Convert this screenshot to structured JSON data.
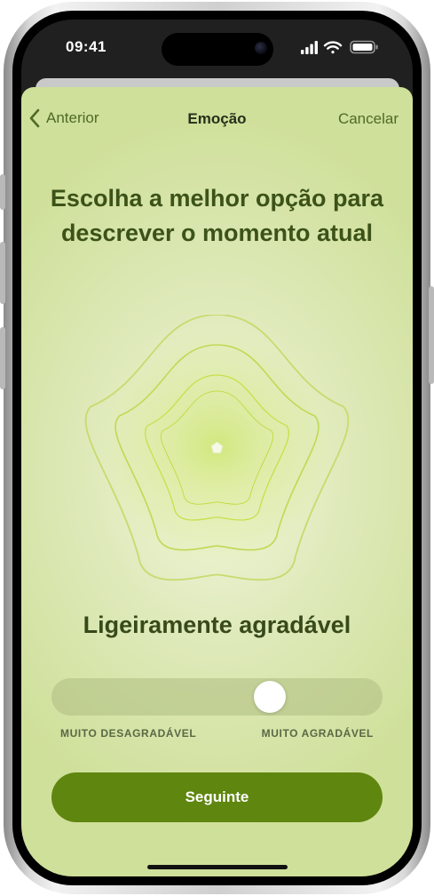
{
  "status_bar": {
    "time": "09:41"
  },
  "nav": {
    "back_label": "Anterior",
    "title": "Emoção",
    "cancel_label": "Cancelar"
  },
  "question": "Escolha a melhor opção para descrever o momento atual",
  "mood_label": "Ligeiramente agradável",
  "slider": {
    "value_fraction": 0.68,
    "min_label": "MUITO DESAGRADÁVEL",
    "max_label": "MUITO AGRADÁVEL"
  },
  "next_button_label": "Seguinte",
  "colors": {
    "accent": "#5f860f",
    "sheet_bg": "#dfeabb",
    "text_dark": "#3c5219"
  },
  "icons": [
    "chevron-left-icon",
    "signal-icon",
    "wifi-icon",
    "battery-icon",
    "mood-flower-icon"
  ]
}
